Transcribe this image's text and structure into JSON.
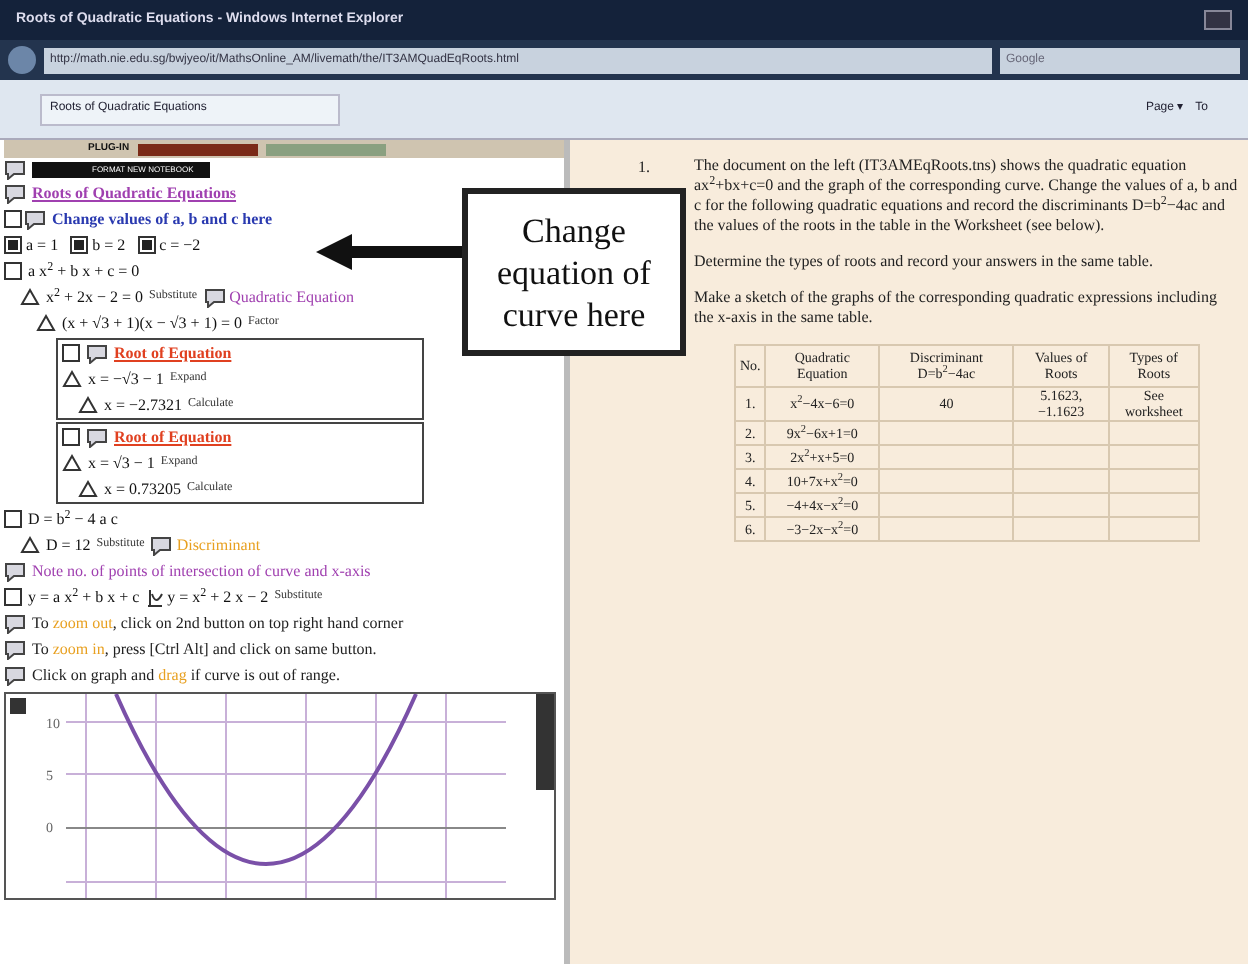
{
  "window": {
    "title": "Roots of Quadratic Equations - Windows Internet Explorer"
  },
  "address_bar": {
    "url": "http://math.nie.edu.sg/bwjyeo/it/MathsOnline_AM/livemath/the/IT3AMQuadEqRoots.html",
    "search_placeholder": "Google"
  },
  "tab": {
    "label": "Roots of Quadratic Equations"
  },
  "command_bar": {
    "items": [
      "Page ▾",
      "To"
    ]
  },
  "plugin_bar": {
    "label": "PLUG-IN",
    "notebook_button": "FORMAT NEW NOTEBOOK"
  },
  "left_document": {
    "lines": [
      {
        "kind": "comment",
        "parts": [
          {
            "kind": "link",
            "text": "Roots of Quadratic Equations"
          }
        ]
      },
      {
        "kind": "section",
        "parts": [
          {
            "kind": "heading",
            "text": "Change values of a, b and c here"
          }
        ]
      },
      {
        "kind": "radios",
        "items": [
          {
            "label": "a = 1",
            "checked": true
          },
          {
            "label": "b = 2",
            "checked": true
          },
          {
            "label": "c = −2",
            "checked": true
          }
        ]
      },
      {
        "kind": "check",
        "parts": [
          {
            "kind": "math",
            "text": "a x$^{2}$ + b x + c = 0"
          }
        ],
        "children": [
          {
            "kind": "step",
            "parts": [
              {
                "kind": "math",
                "text": "x$^{2}$ + 2x − 2 = 0"
              },
              {
                "kind": "tag",
                "text": "Substitute"
              },
              {
                "kind": "comment",
                "text": "Quadratic Equation"
              }
            ],
            "children": [
              {
                "kind": "step",
                "parts": [
                  {
                    "kind": "math",
                    "text": "(x + √3 + 1)(x − √3 + 1) = 0"
                  },
                  {
                    "kind": "tag",
                    "text": "Factor"
                  }
                ]
              },
              {
                "kind": "box",
                "title": "Root of Equation",
                "children": [
                  {
                    "kind": "step",
                    "parts": [
                      {
                        "kind": "math",
                        "text": "x = −√3 − 1"
                      },
                      {
                        "kind": "tag",
                        "text": "Expand"
                      }
                    ],
                    "children": [
                      {
                        "kind": "step",
                        "parts": [
                          {
                            "kind": "math",
                            "text": "x = −2.7321"
                          },
                          {
                            "kind": "tag",
                            "text": "Calculate"
                          }
                        ]
                      }
                    ]
                  }
                ]
              },
              {
                "kind": "box",
                "title": "Root of Equation",
                "children": [
                  {
                    "kind": "step",
                    "parts": [
                      {
                        "kind": "math",
                        "text": "x = √3 − 1"
                      },
                      {
                        "kind": "tag",
                        "text": "Expand"
                      }
                    ],
                    "children": [
                      {
                        "kind": "step",
                        "parts": [
                          {
                            "kind": "math",
                            "text": "x = 0.73205"
                          },
                          {
                            "kind": "tag",
                            "text": "Calculate"
                          }
                        ]
                      }
                    ]
                  }
                ]
              }
            ]
          }
        ]
      },
      {
        "kind": "check",
        "parts": [
          {
            "kind": "math",
            "text": "D = b$^{2}$ − 4 a c"
          }
        ],
        "children": [
          {
            "kind": "step",
            "parts": [
              {
                "kind": "math",
                "text": "D = 12"
              },
              {
                "kind": "tag",
                "text": "Substitute"
              },
              {
                "kind": "warning",
                "text": "Discriminant"
              }
            ]
          }
        ]
      },
      {
        "kind": "comment",
        "parts": [
          {
            "kind": "note",
            "text": "Note no. of points of intersection of curve and x-axis"
          }
        ]
      },
      {
        "kind": "check",
        "parts": [
          {
            "kind": "math",
            "text": "y = a x$^{2}$ + b x + c"
          },
          {
            "kind": "plot",
            "text": "y = x$^{2}$ + 2 x − 2"
          },
          {
            "kind": "tag",
            "text": "Substitute"
          }
        ]
      },
      {
        "kind": "comment",
        "parts": [
          {
            "kind": "instruction",
            "text": "To *zoom out*, click on 2nd button on top right hand corner"
          }
        ]
      },
      {
        "kind": "comment",
        "parts": [
          {
            "kind": "instruction",
            "text": "To *zoom in*, press [Ctrl Alt] and click on same button."
          }
        ]
      },
      {
        "kind": "comment",
        "parts": [
          {
            "kind": "instruction",
            "text": "Click on graph and *drag* if curve is out of range."
          }
        ]
      },
      {
        "kind": "graph",
        "tick_labels": [
          "10",
          "5",
          "0"
        ]
      }
    ]
  },
  "callout": {
    "text": "Change equation of curve here"
  },
  "worksheet": {
    "number": "1.",
    "paragraphs": [
      "The document on the left (IT3AMEqRoots.tns) shows the quadratic equation ax$^{2}$+bx+c=0 and the graph of the corresponding curve. Change the values of a, b and c for the following quadratic equations and record the discriminants D=b$^{2}$−4ac and the values of the roots in the table in the Worksheet (see below).",
      "Determine the types of roots and record your answers in the same table.",
      "Make a sketch of the graphs of the corresponding quadratic expressions including the x-axis in the same table."
    ],
    "table": {
      "columns": [
        "No.",
        "Quadratic Equation",
        "Discriminant D=b$^{2}$−4ac",
        "Values of Roots",
        "Types of Roots"
      ],
      "rows": [
        [
          "1.",
          "x$^{2}$−4x−6=0",
          "40",
          "5.1623, −1.1623",
          "See worksheet"
        ],
        [
          "2.",
          "9x$^{2}$−6x+1=0",
          "",
          "",
          ""
        ],
        [
          "3.",
          "2x$^{2}$+x+5=0",
          "",
          "",
          ""
        ],
        [
          "4.",
          "10+7x+x$^{2}$=0",
          "",
          "",
          ""
        ],
        [
          "5.",
          "−4+4x−x$^{2}$=0",
          "",
          "",
          ""
        ],
        [
          "6.",
          "−3−2x−x$^{2}$=0",
          "",
          "",
          ""
        ]
      ]
    }
  }
}
